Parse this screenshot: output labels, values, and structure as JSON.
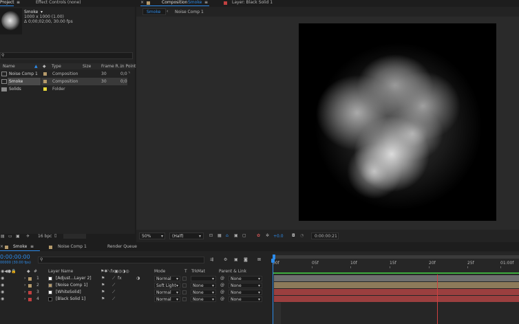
{
  "project": {
    "tab_label": "Project",
    "effect_controls_label": "Effect Controls (none)",
    "preview": {
      "name": "Smoke",
      "dims": "1000 x 1000 (1.00)",
      "duration": "Δ 0;00;02;00, 30.00 fps"
    },
    "search_placeholder": "",
    "columns": {
      "name": "Name",
      "type": "Type",
      "size": "Size",
      "frame_rate": "Frame R...",
      "in_point": "In Point"
    },
    "items": [
      {
        "name": "Noise Comp 1",
        "type": "Composition",
        "size": "",
        "fr": "30",
        "in": "0;0",
        "color": "#b59a6b"
      },
      {
        "name": "Smoke",
        "type": "Composition",
        "size": "",
        "fr": "30",
        "in": "0;0",
        "color": "#b59a6b"
      },
      {
        "name": "Solids",
        "type": "Folder",
        "size": "",
        "fr": "",
        "in": "",
        "color": "#e8d83a"
      }
    ],
    "bpc": "16 bpc"
  },
  "viewer": {
    "comp_prefix": "Composition",
    "comp_name": "Smoke",
    "layer_tab": "Layer: Black Solid 1",
    "breadcrumb_active": "Smoke",
    "breadcrumb_next": "Noise Comp 1",
    "zoom": "50%",
    "resolution": "(Half)",
    "exposure": "+0.0",
    "timecode": "0:00:00:21"
  },
  "timeline": {
    "tabs": [
      {
        "label": "Smoke",
        "color": "#b59a6b"
      },
      {
        "label": "Noise Comp 1",
        "color": "#b59a6b"
      },
      {
        "label": "Render Queue",
        "color": ""
      }
    ],
    "current_time": "0:00:00:00",
    "frame_info": "00000 (30.00 fps)",
    "search_placeholder": "",
    "headers": {
      "layer_name": "Layer Name",
      "mode": "Mode",
      "t": "T",
      "trkmat": "TrkMat",
      "parent": "Parent & Link"
    },
    "ruler": [
      "00f",
      "05f",
      "10f",
      "15f",
      "20f",
      "25f",
      "01:00f"
    ],
    "layers": [
      {
        "num": "1",
        "name": "[Adjust...Layer 2]",
        "mode": "Normal",
        "trkmat": "",
        "parent": "None",
        "color": "#b59a6b",
        "thumb": "#ffffff"
      },
      {
        "num": "2",
        "name": "[Noise Comp 1]",
        "mode": "Soft Light",
        "trkmat": "None",
        "parent": "None",
        "color": "#b59a6b",
        "thumb": "#b59a6b"
      },
      {
        "num": "3",
        "name": "[WhiteSolid]",
        "mode": "Normal",
        "trkmat": "None",
        "parent": "None",
        "color": "#c24040",
        "thumb": "#ffffff"
      },
      {
        "num": "4",
        "name": "[Black Solid 1]",
        "mode": "Normal",
        "trkmat": "None",
        "parent": "None",
        "color": "#c24040",
        "thumb": "#000000"
      }
    ]
  }
}
